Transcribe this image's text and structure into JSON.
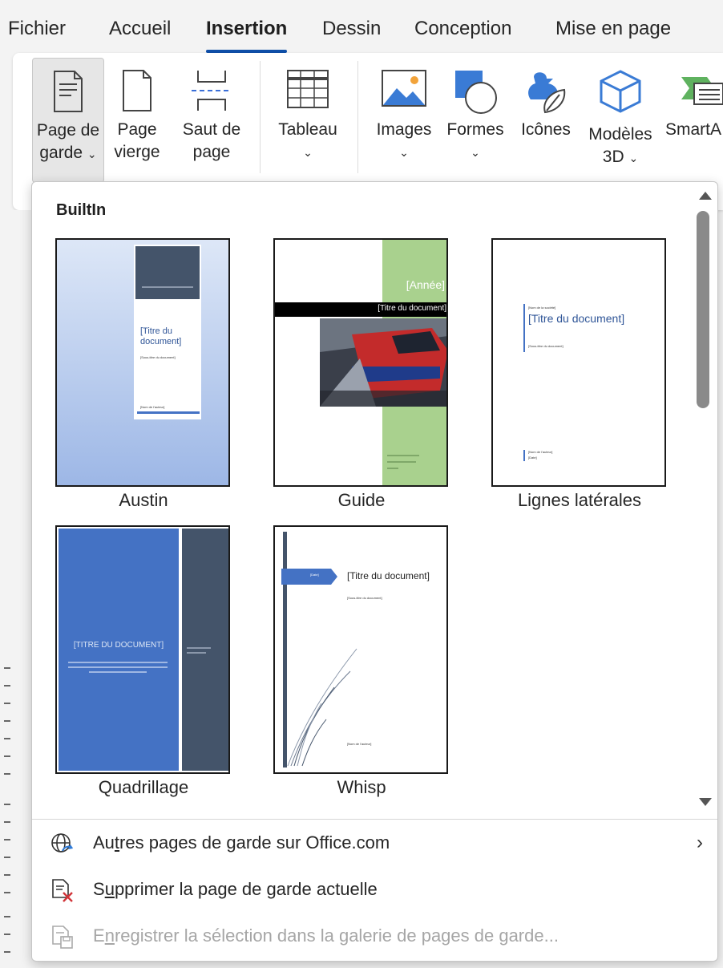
{
  "tabs": [
    {
      "label": "Fichier"
    },
    {
      "label": "Accueil"
    },
    {
      "label": "Insertion"
    },
    {
      "label": "Dessin"
    },
    {
      "label": "Conception"
    },
    {
      "label": "Mise en page"
    }
  ],
  "ribbon": {
    "page_de_garde": {
      "line1": "Page de",
      "line2": "garde",
      "chev": "⌄"
    },
    "page_vierge": {
      "line1": "Page",
      "line2": "vierge"
    },
    "saut_de_page": {
      "line1": "Saut de",
      "line2": "page"
    },
    "tableau": {
      "line1": "Tableau",
      "chev": "⌄"
    },
    "images": {
      "line1": "Images",
      "chev": "⌄"
    },
    "formes": {
      "line1": "Formes",
      "chev": "⌄"
    },
    "icones": {
      "line1": "Icônes"
    },
    "modeles3d": {
      "line1": "Modèles",
      "line2": "3D",
      "chev": "⌄"
    },
    "smartart": {
      "line1": "SmartA"
    }
  },
  "gallery": {
    "section_title": "BuiltIn",
    "items": [
      {
        "caption": "Austin",
        "title": "[Titre du document]",
        "subtitle": "[Sous-titre du document]",
        "author": "[Nom de l'auteur]"
      },
      {
        "caption": "Guide",
        "year": "[Année]",
        "title": "[Titre du document]"
      },
      {
        "caption": "Lignes latérales",
        "company": "[Nom de la société]",
        "title": "[Titre du document]",
        "subtitle": "[Sous-titre du document]",
        "author": "[Nom de l'auteur]",
        "date": "[Date]"
      },
      {
        "caption": "Quadrillage",
        "title": "[TITRE DU DOCUMENT]"
      },
      {
        "caption": "Whisp",
        "year": "[Date]",
        "title": "[Titre du document]",
        "subtitle": "[Sous-titre du document]",
        "author": "[Nom de l'auteur]"
      }
    ]
  },
  "menu": {
    "more_pages_pre": "Au",
    "more_pages_u": "t",
    "more_pages_post": "res pages de garde sur Office.com",
    "remove_pre": "S",
    "remove_u": "u",
    "remove_post": "pprimer la page de garde actuelle",
    "save_pre": "E",
    "save_u": "n",
    "save_post": "registrer la sélection dans la galerie de pages de garde...",
    "arrow": "›"
  },
  "colors": {
    "austin_blue": "#9db7e6",
    "guide_green": "#a9d18e",
    "grid_blue": "#4472c4",
    "grid_dark": "#44546a",
    "accent_blue": "#2f5597"
  }
}
